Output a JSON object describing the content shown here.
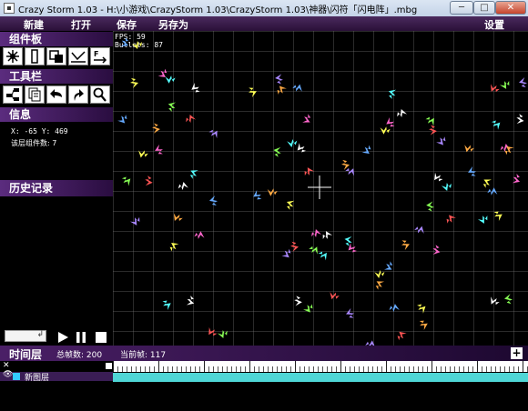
{
  "window": {
    "title": "Crazy Storm 1.03 - H:\\小游戏\\CrazyStorm 1.03\\CrazyStorm 1.03\\神器\\闪符「闪电阵」.mbg",
    "min_label": "─",
    "max_label": "□",
    "close_label": "✕"
  },
  "menu": {
    "new": "新建",
    "open": "打开",
    "save": "保存",
    "save_as": "另存为",
    "settings": "设置"
  },
  "sidebar": {
    "components_title": "组件板",
    "toolbar_title": "工具栏",
    "info_title": "信息",
    "history_title": "历史记录",
    "coords": "X: -65  Y: 469",
    "component_count": "该层组件数: 7"
  },
  "canvas": {
    "fps": "FPS: 59",
    "bullets": "Bullets: 87"
  },
  "timeline": {
    "title": "时间层",
    "total_frames": "总帧数: 200",
    "current_frame": "当前帧: 117",
    "add_label": "+",
    "close_label": "✕",
    "layer_name": "新图层",
    "layer_color": "#33ccff"
  },
  "colors": {
    "accent": "#5b2c7e",
    "track": "#4fd6d6"
  }
}
